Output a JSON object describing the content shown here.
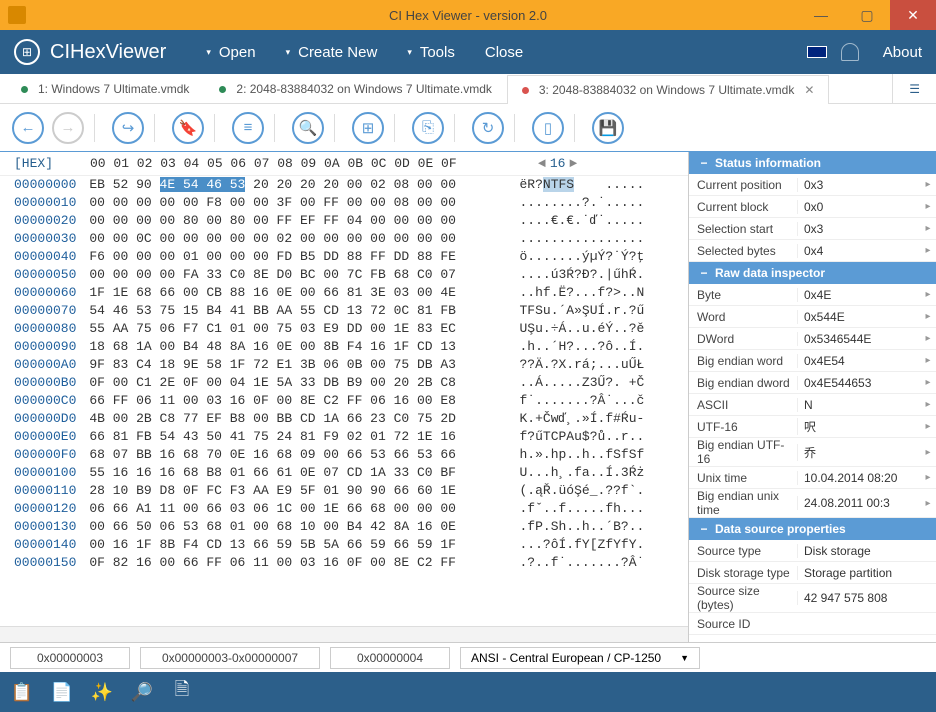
{
  "title": "CI Hex Viewer - version 2.0",
  "app": "CIHexViewer",
  "menu": {
    "open": "Open",
    "create": "Create New",
    "tools": "Tools",
    "close": "Close",
    "about": "About"
  },
  "tabs": [
    {
      "label": "1: Windows 7 Ultimate.vmdk",
      "dot": "#2e8b57"
    },
    {
      "label": "2: 2048-83884032 on Windows 7 Ultimate.vmdk",
      "dot": "#2e8b57"
    },
    {
      "label": "3: 2048-83884032 on Windows 7 Ultimate.vmdk",
      "dot": "#d9534f"
    }
  ],
  "hex": {
    "label": "[HEX]",
    "heads": "00 01 02 03 04 05 06 07 08 09 0A 0B 0C 0D 0E 0F",
    "page": "16",
    "rows": [
      {
        "off": "00000000",
        "b0": "EB 52 90 ",
        "b1": "4E 54 46 53",
        "b2": " 20 20 20 20 00 02 08 00 00",
        "a0": "ëR?",
        "a1": "NTFS",
        "a2": "    ....."
      },
      {
        "off": "00000010",
        "b": "00 00 00 00 00 F8 00 00 3F 00 FF 00 00 08 00 00",
        "a": "........?.˙....."
      },
      {
        "off": "00000020",
        "b": "00 00 00 00 80 00 80 00 FF EF FF 04 00 00 00 00",
        "a": "....€.€.˙ď˙....."
      },
      {
        "off": "00000030",
        "b": "00 00 0C 00 00 00 00 00 02 00 00 00 00 00 00 00",
        "a": "................"
      },
      {
        "off": "00000040",
        "b": "F6 00 00 00 01 00 00 00 FD B5 DD 88 FF DD 88 FE",
        "a": "ö.......ýµÝ?˙Ý?ţ"
      },
      {
        "off": "00000050",
        "b": "00 00 00 00 FA 33 C0 8E D0 BC 00 7C FB 68 C0 07",
        "a": "....ú3Ŕ?Đ?.|űhŔ."
      },
      {
        "off": "00000060",
        "b": "1F 1E 68 66 00 CB 88 16 0E 00 66 81 3E 03 00 4E",
        "a": "..hf.Ë?...f?>..N"
      },
      {
        "off": "00000070",
        "b": "54 46 53 75 15 B4 41 BB AA 55 CD 13 72 0C 81 FB",
        "a": "TFSu.´A»ŞUÍ.r.?ű"
      },
      {
        "off": "00000080",
        "b": "55 AA 75 06 F7 C1 01 00 75 03 E9 DD 00 1E 83 EC",
        "a": "UŞu.÷Á..u.éÝ..?ě"
      },
      {
        "off": "00000090",
        "b": "18 68 1A 00 B4 48 8A 16 0E 00 8B F4 16 1F CD 13",
        "a": ".h..´H?...?ô..Í."
      },
      {
        "off": "000000A0",
        "b": "9F 83 C4 18 9E 58 1F 72 E1 3B 06 0B 00 75 DB A3",
        "a": "??Ä.?X.rá;...uŰŁ"
      },
      {
        "off": "000000B0",
        "b": "0F 00 C1 2E 0F 00 04 1E 5A 33 DB B9 00 20 2B C8",
        "a": "..Á.....Z3Ű?. +Č"
      },
      {
        "off": "000000C0",
        "b": "66 FF 06 11 00 03 16 0F 00 8E C2 FF 06 16 00 E8",
        "a": "f˙.......?Â˙...č"
      },
      {
        "off": "000000D0",
        "b": "4B 00 2B C8 77 EF B8 00 BB CD 1A 66 23 C0 75 2D",
        "a": "K.+Čwď¸.»Í.f#Ŕu-"
      },
      {
        "off": "000000E0",
        "b": "66 81 FB 54 43 50 41 75 24 81 F9 02 01 72 1E 16",
        "a": "f?űTCPAu$?ů..r.."
      },
      {
        "off": "000000F0",
        "b": "68 07 BB 16 68 70 0E 16 68 09 00 66 53 66 53 66",
        "a": "h.».hp..h..fSfSf"
      },
      {
        "off": "00000100",
        "b": "55 16 16 16 68 B8 01 66 61 0E 07 CD 1A 33 C0 BF",
        "a": "U...h¸.fa..Í.3Ŕż"
      },
      {
        "off": "00000110",
        "b": "28 10 B9 D8 0F FC F3 AA E9 5F 01 90 90 66 60 1E",
        "a": "(.ąŘ.üóŞé_.??f`."
      },
      {
        "off": "00000120",
        "b": "06 66 A1 11 00 66 03 06 1C 00 1E 66 68 00 00 00",
        "a": ".fˇ..f.....fh..."
      },
      {
        "off": "00000130",
        "b": "00 66 50 06 53 68 01 00 68 10 00 B4 42 8A 16 0E",
        "a": ".fP.Sh..h..´B?.."
      },
      {
        "off": "00000140",
        "b": "00 16 1F 8B F4 CD 13 66 59 5B 5A 66 59 66 59 1F",
        "a": "...?ôÍ.fY[ZfYfY."
      },
      {
        "off": "00000150",
        "b": "0F 82 16 00 66 FF 06 11 00 03 16 0F 00 8E C2 FF",
        "a": ".?..f˙.......?Â˙"
      }
    ]
  },
  "sections": {
    "status_info": "Status information",
    "raw": "Raw data inspector",
    "ds": "Data source properties"
  },
  "status_rows": [
    {
      "l": "Current position",
      "v": "0x3"
    },
    {
      "l": "Current block",
      "v": "0x0"
    },
    {
      "l": "Selection start",
      "v": "0x3"
    },
    {
      "l": "Selected bytes",
      "v": "0x4"
    }
  ],
  "raw_rows": [
    {
      "l": "Byte",
      "v": "0x4E"
    },
    {
      "l": "Word",
      "v": "0x544E"
    },
    {
      "l": "DWord",
      "v": "0x5346544E"
    },
    {
      "l": "Big endian word",
      "v": "0x4E54"
    },
    {
      "l": "Big endian dword",
      "v": "0x4E544653"
    },
    {
      "l": "ASCII",
      "v": "N"
    },
    {
      "l": "UTF-16",
      "v": "呎"
    },
    {
      "l": "Big endian UTF-16",
      "v": "乔"
    },
    {
      "l": "Unix time",
      "v": "10.04.2014 08:20"
    },
    {
      "l": "Big endian unix time",
      "v": "24.08.2011 00:3"
    }
  ],
  "ds_rows": [
    {
      "l": "Source type",
      "v": "Disk storage"
    },
    {
      "l": "Disk storage type",
      "v": "Storage partition"
    },
    {
      "l": "Source size (bytes)",
      "v": "42 947 575 808"
    },
    {
      "l": "Source ID",
      "v": ""
    }
  ],
  "footer": {
    "pos": "0x00000003",
    "range": "0x00000003-0x00000007",
    "len": "0x00000004",
    "enc": "ANSI - Central European / CP-1250"
  }
}
